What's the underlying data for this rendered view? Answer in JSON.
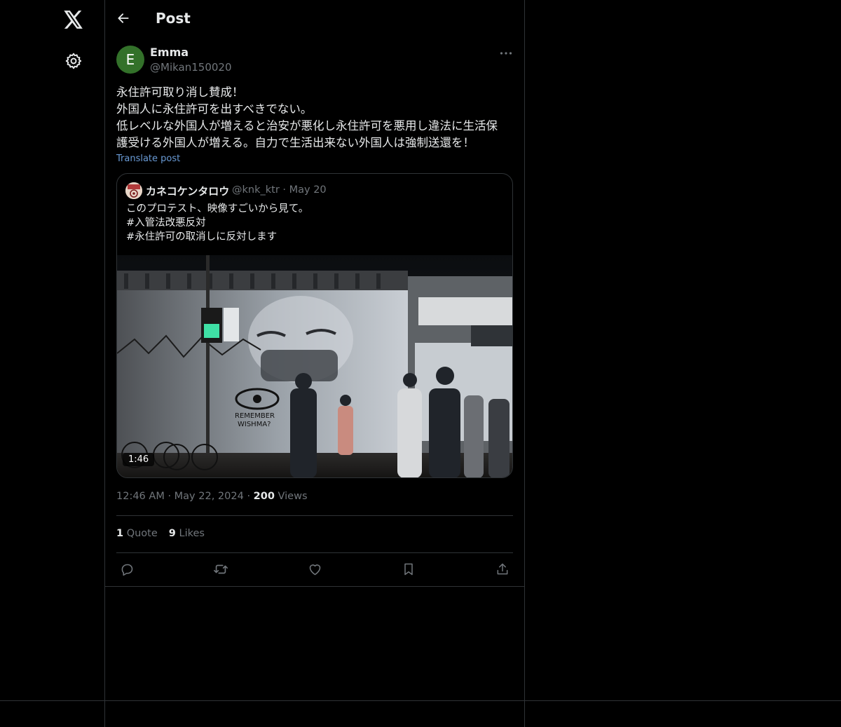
{
  "nav": {
    "logo_icon": "x-logo-icon",
    "settings_icon": "gear-icon"
  },
  "header": {
    "title": "Post"
  },
  "post": {
    "avatar_letter": "E",
    "avatar_color": "#33712a",
    "display_name": "Emma",
    "handle": "@Mikan150020",
    "lines": [
      "永住許可取り消し賛成！",
      "外国人に永住許可を出すべきでない。",
      "低レベルな外国人が増えると治安が悪化し永住許可を悪用し違法に生活保",
      "護受ける外国人が増える。自力で生活出来ない外国人は強制送還を！"
    ],
    "translate_label": "Translate post",
    "time": "12:46 AM",
    "date": "May 22, 2024",
    "views_count": "200",
    "views_label": "Views",
    "quote_count": "1",
    "quote_label": "Quote",
    "likes_count": "9",
    "likes_label": "Likes"
  },
  "quoted": {
    "name": "カネコケンタロウ",
    "handle": "@knk_ktr",
    "date": "May 20",
    "lines": [
      "このプロテスト、映像すごいから見て。",
      "#入管法改悪反対",
      " #永住許可の取消しに反対します"
    ],
    "video_duration": "1:46"
  },
  "colors": {
    "background": "#000000",
    "border": "#2f3336",
    "text_primary": "#e7e9ea",
    "text_secondary": "#71767b",
    "link": "#6a9bd6"
  }
}
